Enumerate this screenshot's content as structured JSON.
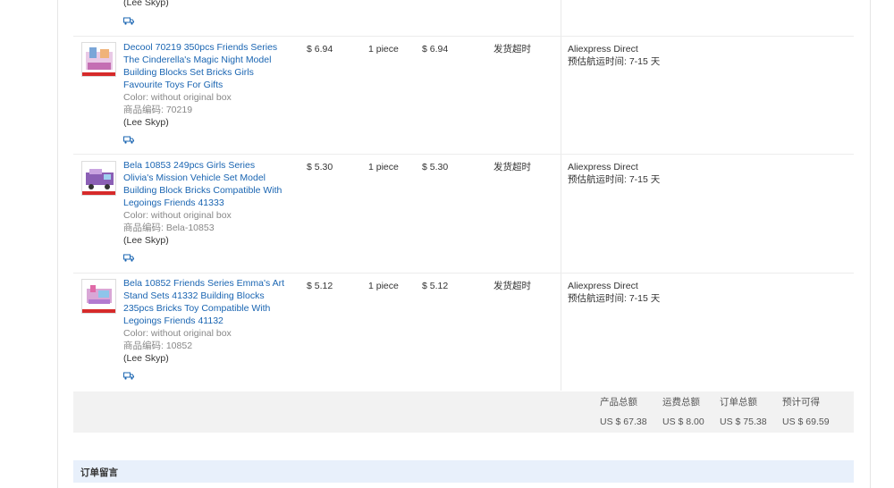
{
  "top_seller": "(Lee Skyp)",
  "items": [
    {
      "name": "Decool 70219 350pcs Friends Series The Cinderella's Magic Night Model Building Blocks Set Bricks Girls Favourite Toys For Gifts",
      "color": "Color: without original box",
      "code": "商品编码: 70219",
      "seller": "(Lee Skyp)",
      "price": "$ 6.94",
      "qty": "1 piece",
      "total": "$ 6.94",
      "status": "发货超时",
      "shipping": "Aliexpress Direct",
      "eta": "预估航运时间: 7-15 天"
    },
    {
      "name": "Bela 10853 249pcs Girls Series Olivia's Mission Vehicle Set Model Building Block Bricks Compatible With Legoings Friends 41333",
      "color": "Color: without original box",
      "code": "商品编码: Bela-10853",
      "seller": "(Lee Skyp)",
      "price": "$ 5.30",
      "qty": "1 piece",
      "total": "$ 5.30",
      "status": "发货超时",
      "shipping": "Aliexpress Direct",
      "eta": "预估航运时间: 7-15 天"
    },
    {
      "name": "Bela 10852 Friends Series Emma's Art Stand Sets 41332 Building Blocks 235pcs Bricks Toy Compatible With Legoings Friends 41132",
      "color": "Color: without original box",
      "code": "商品编码: 10852",
      "seller": "(Lee Skyp)",
      "price": "$ 5.12",
      "qty": "1 piece",
      "total": "$ 5.12",
      "status": "发货超时",
      "shipping": "Aliexpress Direct",
      "eta": "预估航运时间: 7-15 天"
    }
  ],
  "summary": {
    "product_total_label": "产品总额",
    "product_total": "US $ 67.38",
    "shipping_total_label": "运费总额",
    "shipping_total": "US $ 8.00",
    "order_total_label": "订单总额",
    "order_total": "US $ 75.38",
    "payable_label": "预计可得",
    "payable": "US $ 69.59"
  },
  "remark_label": "订单留言",
  "colors": {
    "link": "#1a65b2",
    "summary_bg": "#f2f2f2",
    "remark_bg": "#e8f0fb"
  }
}
